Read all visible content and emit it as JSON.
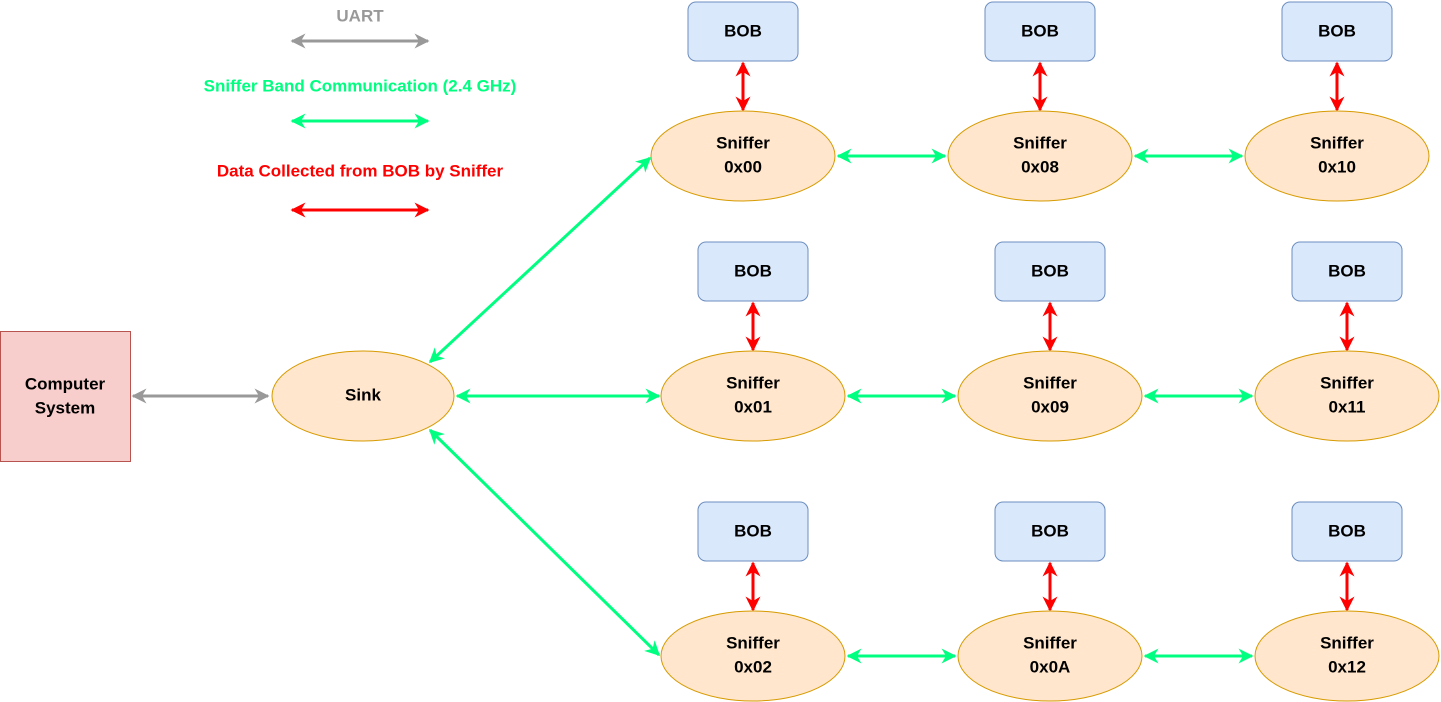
{
  "legend": {
    "uart": {
      "label": "UART",
      "color": "#999999"
    },
    "sniffer_band": {
      "label": "Sniffer Band Communication (2.4 GHz)",
      "color": "#00ff80"
    },
    "bob_data": {
      "label": "Data Collected from BOB by Sniffer",
      "color": "#ff0000"
    }
  },
  "colors": {
    "computer_fill": "#f8cecc",
    "computer_stroke": "#b85450",
    "sink_fill": "#ffe6cc",
    "sink_stroke": "#d79b00",
    "bob_fill": "#dae8fc",
    "bob_stroke": "#6c8ebf"
  },
  "computer": {
    "line1": "Computer",
    "line2": "System"
  },
  "sink": {
    "label": "Sink"
  },
  "bob_label": "BOB",
  "rows": [
    {
      "sniffers": [
        {
          "line1": "Sniffer",
          "line2": "0x00"
        },
        {
          "line1": "Sniffer",
          "line2": "0x08"
        },
        {
          "line1": "Sniffer",
          "line2": "0x10"
        }
      ]
    },
    {
      "sniffers": [
        {
          "line1": "Sniffer",
          "line2": "0x01"
        },
        {
          "line1": "Sniffer",
          "line2": "0x09"
        },
        {
          "line1": "Sniffer",
          "line2": "0x11"
        }
      ]
    },
    {
      "sniffers": [
        {
          "line1": "Sniffer",
          "line2": "0x02"
        },
        {
          "line1": "Sniffer",
          "line2": "0x0A"
        },
        {
          "line1": "Sniffer",
          "line2": "0x12"
        }
      ]
    }
  ]
}
